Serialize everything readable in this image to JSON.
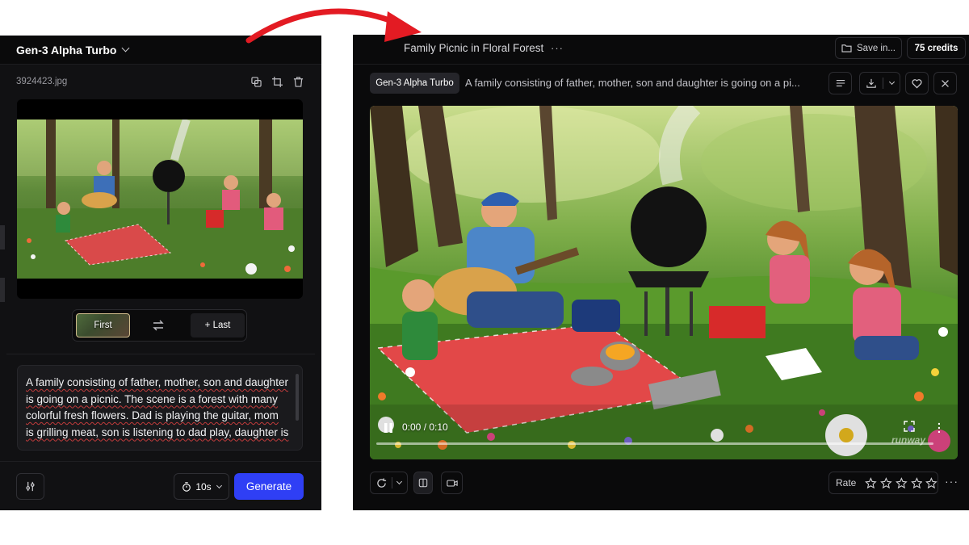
{
  "left_panel": {
    "model_title": "Gen-3 Alpha Turbo",
    "file_name": "3924423.jpg",
    "frame_toggle": {
      "first_label": "First",
      "last_label": "+ Last"
    },
    "prompt": "A family consisting of father, mother, son and daughter is going on a picnic. The scene is a forest with many colorful fresh flowers. Dad is playing the guitar, mom is grilling meat, son is listening to dad play, daughter is",
    "duration_label": "10s",
    "generate_label": "Generate"
  },
  "right_panel": {
    "title": "Family Picnic in Floral Forest",
    "title_menu": "···",
    "save_label": "Save in...",
    "credits_label": "75 credits",
    "model_chip": "Gen-3 Alpha Turbo",
    "prompt_preview": "A family consisting of father, mother, son and daughter is going on a pi...",
    "video": {
      "time_label": "0:00 / 0:10",
      "progress": 0,
      "watermark": "runway"
    },
    "rate_label": "Rate",
    "rating_stars": 5,
    "more_label": "···"
  },
  "colors": {
    "generate_blue": "#2f3ff5",
    "arrow_red": "#e31b23",
    "panel_bg": "#111113"
  }
}
